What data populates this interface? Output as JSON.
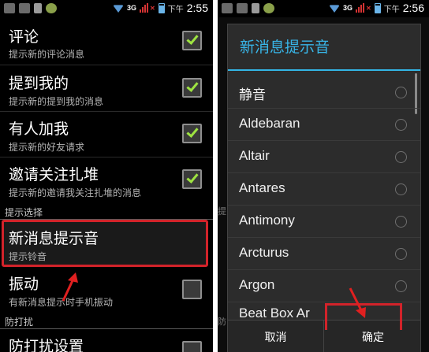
{
  "left_screen": {
    "status": {
      "network": "3G",
      "ampm": "下午",
      "time": "2:55"
    },
    "settings": [
      {
        "title": "评论",
        "summary": "提示新的评论消息",
        "checked": true
      },
      {
        "title": "提到我的",
        "summary": "提示新的提到我的消息",
        "checked": true
      },
      {
        "title": "有人加我",
        "summary": "提示新的好友请求",
        "checked": true
      },
      {
        "title": "邀请关注扎堆",
        "summary": "提示新的邀请我关注扎堆的消息",
        "checked": true
      }
    ],
    "category_tips": "提示选择",
    "ringtone": {
      "title": "新消息提示音",
      "summary": "提示铃音"
    },
    "vibrate": {
      "title": "振动",
      "summary": "有新消息提示时手机振动",
      "checked": false
    },
    "category_dnd": "防打扰",
    "dnd": {
      "title": "防打扰设置",
      "checked": false
    }
  },
  "right_screen": {
    "status": {
      "network": "3G",
      "ampm": "下午",
      "time": "2:56"
    },
    "dialog": {
      "title": "新消息提示音",
      "options": [
        "静音",
        "Aldebaran",
        "Altair",
        "Antares",
        "Antimony",
        "Arcturus",
        "Argon",
        "Beat Box Ar"
      ],
      "cancel_label": "取消",
      "ok_label": "确定"
    },
    "peek": {
      "edge_1": "提",
      "edge_2": "防"
    }
  },
  "colors": {
    "accent": "#33b5e5",
    "highlight": "#d2232a",
    "check": "#9ee341"
  }
}
